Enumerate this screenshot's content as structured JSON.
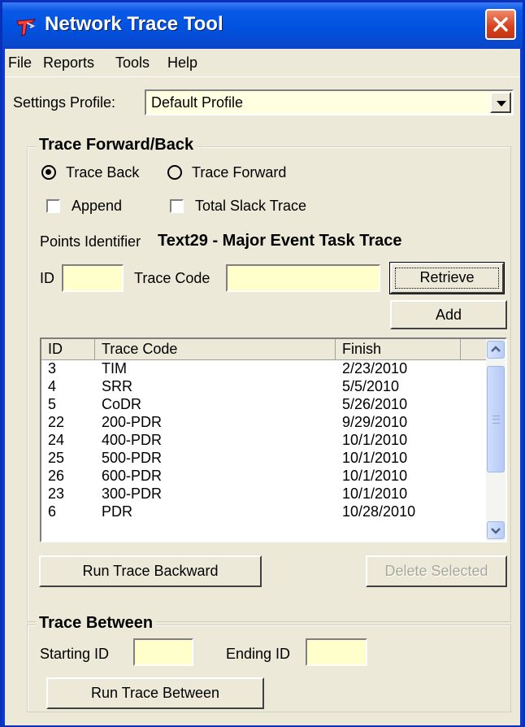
{
  "window": {
    "title": "Network Trace Tool",
    "accent": "#0054e3",
    "client_bg": "#ece9d8",
    "field_bg": "#ffffcc"
  },
  "menu": [
    "File",
    "Reports",
    "Tools",
    "Help"
  ],
  "settings": {
    "label": "Settings Profile:",
    "value": "Default Profile"
  },
  "trace_group": {
    "title": "Trace Forward/Back",
    "radio_back": "Trace Back",
    "radio_forward": "Trace Forward",
    "selected": "Trace Back",
    "append": "Append",
    "append_checked": false,
    "slack": "Total Slack Trace",
    "slack_checked": false,
    "points_label": "Points Identifier",
    "points_value": "Text29 - Major Event Task Trace",
    "id_label": "ID",
    "id_value": "",
    "code_label": "Trace Code",
    "code_value": "",
    "retrieve": "Retrieve",
    "add": "Add",
    "run_back": "Run Trace Backward",
    "delete": "Delete Selected",
    "columns": [
      "ID",
      "Trace Code",
      "Finish"
    ],
    "rows": [
      [
        "3",
        "TIM",
        "2/23/2010"
      ],
      [
        "4",
        "SRR",
        "5/5/2010"
      ],
      [
        "5",
        "CoDR",
        "5/26/2010"
      ],
      [
        "22",
        "200-PDR",
        "9/29/2010"
      ],
      [
        "24",
        "400-PDR",
        "10/1/2010"
      ],
      [
        "25",
        "500-PDR",
        "10/1/2010"
      ],
      [
        "26",
        "600-PDR",
        "10/1/2010"
      ],
      [
        "23",
        "300-PDR",
        "10/1/2010"
      ],
      [
        "6",
        "PDR",
        "10/28/2010"
      ]
    ]
  },
  "between_group": {
    "title": "Trace Between",
    "start_label": "Starting ID",
    "start_value": "",
    "end_label": "Ending ID",
    "end_value": "",
    "run": "Run Trace Between"
  },
  "icons": [
    "app-icon",
    "close-icon",
    "dropdown-arrow-icon",
    "scroll-up-icon",
    "scroll-down-icon"
  ]
}
